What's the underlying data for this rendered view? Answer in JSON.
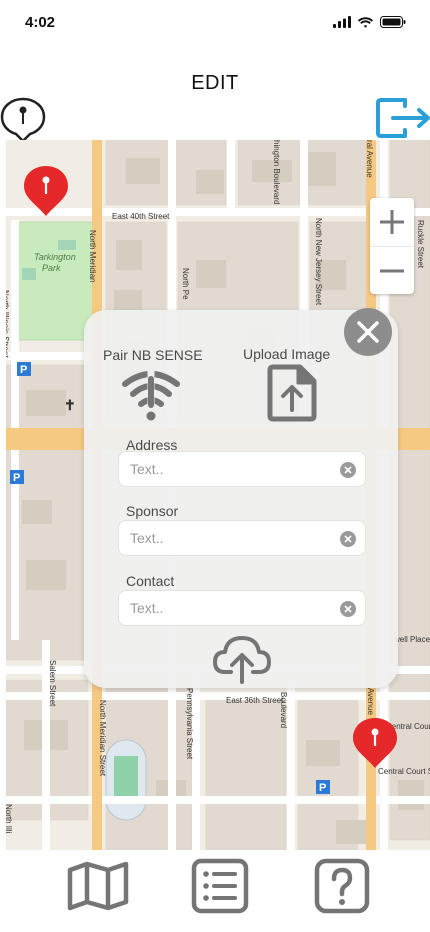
{
  "status_bar": {
    "time": "4:02"
  },
  "header": {
    "title": "EDIT"
  },
  "map": {
    "street_labels": [
      "East 40th Street",
      "East 36th Street",
      "North Meridian Street",
      "North Meridian Street",
      "North Pennsylvania Street",
      "Pennsylvania Street",
      "North New Jersey Street",
      "Washington Boulevard",
      "Boulevard",
      "Central Avenue",
      "Avenue",
      "Ruckle Street",
      "Salem Street",
      "North Illinois Street",
      "North Illi",
      "Central Court",
      "Central Court South",
      "Tarkington Park",
      "Hartwell Place"
    ],
    "park_label": "Tarkington Park"
  },
  "popup": {
    "pair_label": "Pair NB SENSE",
    "upload_label": "Upload Image",
    "fields": [
      {
        "label": "Address",
        "placeholder": "Text..",
        "value": ""
      },
      {
        "label": "Sponsor",
        "placeholder": "Text..",
        "value": ""
      },
      {
        "label": "Contact",
        "placeholder": "Text..",
        "value": ""
      }
    ]
  },
  "icons": {
    "pin_outline": "map-pin-outline-icon",
    "exit": "logout-icon",
    "zoom_in": "plus-icon",
    "zoom_out": "minus-icon",
    "marker": "red-map-marker-icon",
    "pair": "wifi-off-icon",
    "upload": "file-upload-icon",
    "cloud": "cloud-upload-icon",
    "close": "close-icon",
    "map_tab": "map-icon",
    "list_tab": "list-icon",
    "help_tab": "help-icon"
  },
  "colors": {
    "accent": "#2a9fd8",
    "marker_red": "#e5292a",
    "icon_gray": "#757575",
    "map_bg": "#f2ede4",
    "road_major": "#f6c983",
    "park_green": "#c8ebbd"
  }
}
